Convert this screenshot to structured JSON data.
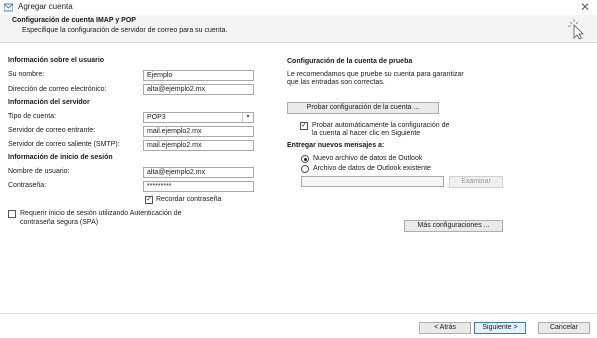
{
  "window": {
    "title": "Agregar cuenta"
  },
  "header": {
    "title": "Configuración de cuenta IMAP y POP",
    "subtitle": "Especifique la configuración de servidor de correo para su cuenta."
  },
  "user_info": {
    "section": "Información sobre el usuario",
    "name_label": "Su nombre:",
    "name_value": "Ejemplo",
    "email_label": "Dirección de correo electrónico:",
    "email_value": "alta@ejemplo2.mx"
  },
  "server_info": {
    "section": "Información del servidor",
    "account_type_label": "Tipo de cuenta:",
    "account_type_value": "POP3",
    "incoming_label": "Servidor de correo entrante:",
    "incoming_value": "mail.ejemplo2.mx",
    "outgoing_label": "Servidor de correo saliente (SMTP):",
    "outgoing_value": "mail.ejemplo2.mx"
  },
  "logon_info": {
    "section": "Información de inicio de sesión",
    "username_label": "Nombre de usuario:",
    "username_value": "alta@ejemplo2.mx",
    "password_label": "Contraseña:",
    "password_value": "*********",
    "remember_label": "Recordar contraseña",
    "remember_checked": true
  },
  "spa": {
    "label_line1": "Requerir inicio de sesión utilizando Autenticación de",
    "label_line2": "contraseña segura (SPA)",
    "checked": false
  },
  "test": {
    "section": "Configuración de la cuenta de prueba",
    "desc_line1": "Le recomendamos que pruebe su cuenta para garantizar",
    "desc_line2": "que las entradas son correctas.",
    "button": "Probar configuración de la cuenta ...",
    "auto_line1": "Probar automáticamente la configuración de",
    "auto_line2": "la cuenta al hacer clic en Siguiente",
    "auto_checked": true
  },
  "deliver": {
    "section": "Entregar nuevos mensajes a:",
    "option_new": "Nuevo archivo de datos de Outlook",
    "option_existing": "Archivo de datos de Outlook existente",
    "selected": "new",
    "browse_button": "Examinar",
    "path_value": ""
  },
  "more_settings": {
    "button": "Más configuraciones ..."
  },
  "footer": {
    "back": "< Atrás",
    "next": "Siguiente >",
    "cancel": "Cancelar"
  }
}
